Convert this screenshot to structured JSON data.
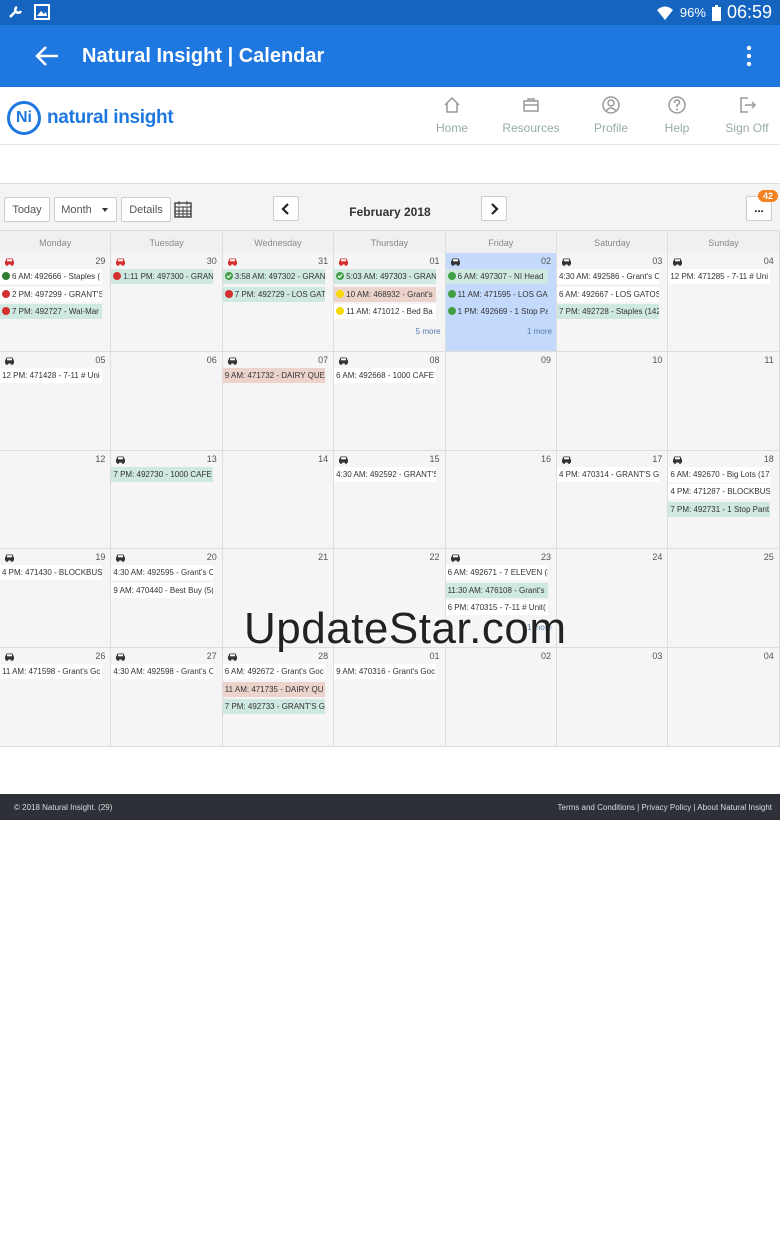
{
  "status": {
    "battery": "96%",
    "time": "06:59"
  },
  "appbar": {
    "title": "Natural Insight | Calendar"
  },
  "brand": {
    "logo_mark": "Ni",
    "logo_text": "natural insight",
    "nav": [
      {
        "label": "Home",
        "icon": "home-icon"
      },
      {
        "label": "Resources",
        "icon": "briefcase-icon"
      },
      {
        "label": "Profile",
        "icon": "user-icon"
      },
      {
        "label": "Help",
        "icon": "help-icon"
      },
      {
        "label": "Sign Off",
        "icon": "sign-out-icon"
      }
    ]
  },
  "toolbar": {
    "today": "Today",
    "view": "Month",
    "details": "Details",
    "month_title": "February 2018",
    "more": "...",
    "badge": "42"
  },
  "calendar": {
    "headers": [
      "Monday",
      "Tuesday",
      "Wednesday",
      "Thursday",
      "Friday",
      "Saturday",
      "Sunday"
    ],
    "weeks": [
      [
        {
          "day": "29",
          "car": "red",
          "events": [
            {
              "text": "6 AM: 492666 - Staples (",
              "dot": "shield"
            },
            {
              "text": "2 PM: 497299 - GRANT'S",
              "dot": "red"
            },
            {
              "text": "7 PM: 492727 - Wal-Mar",
              "dot": "red",
              "style": "green"
            }
          ]
        },
        {
          "day": "30",
          "car": "red",
          "events": [
            {
              "text": "1:11 PM: 497300 - GRAN",
              "dot": "red",
              "style": "green"
            }
          ]
        },
        {
          "day": "31",
          "car": "red",
          "events": [
            {
              "text": "3:58 AM: 497302 - GRAN",
              "dot": "check",
              "style": "green"
            },
            {
              "text": "7 PM: 492729 - LOS GAT",
              "dot": "red",
              "style": "green"
            }
          ]
        },
        {
          "day": "01",
          "car": "red",
          "events": [
            {
              "text": "5:03 AM: 497303 - GRAN",
              "dot": "check",
              "style": "green"
            },
            {
              "text": "10 AM: 468932 - Grant's",
              "dot": "yellow",
              "style": "pink"
            },
            {
              "text": "11 AM: 471012 - Bed Ba",
              "dot": "yellow"
            }
          ],
          "more": "5 more"
        },
        {
          "day": "02",
          "car": "dark",
          "today": true,
          "events": [
            {
              "text": "6 AM: 497307 - NI Head",
              "dot": "green",
              "style": "green"
            },
            {
              "text": "11 AM: 471595 - LOS GA",
              "dot": "green"
            },
            {
              "text": "1 PM: 492669 - 1 Stop Pa",
              "dot": "green"
            }
          ],
          "more": "1 more"
        },
        {
          "day": "03",
          "car": "dark",
          "events": [
            {
              "text": "4:30 AM: 492586 - Grant's C"
            },
            {
              "text": "6 AM: 492667 - LOS GATOS"
            },
            {
              "text": "7 PM: 492728 - Staples (142",
              "style": "green"
            }
          ]
        },
        {
          "day": "04",
          "car": "dark",
          "events": [
            {
              "text": "12 PM: 471285 - 7-11 # Uni"
            }
          ]
        }
      ],
      [
        {
          "day": "05",
          "car": "dark",
          "events": [
            {
              "text": "12 PM: 471428 - 7-11 # Uni"
            }
          ]
        },
        {
          "day": "06",
          "events": []
        },
        {
          "day": "07",
          "car": "dark",
          "events": [
            {
              "text": "9 AM: 471732 - DAIRY QUE",
              "style": "pink"
            }
          ]
        },
        {
          "day": "08",
          "car": "dark",
          "events": [
            {
              "text": "6 AM: 492668 - 1000 CAFE -"
            }
          ]
        },
        {
          "day": "09",
          "events": []
        },
        {
          "day": "10",
          "events": []
        },
        {
          "day": "11",
          "events": []
        }
      ],
      [
        {
          "day": "12",
          "events": []
        },
        {
          "day": "13",
          "car": "dark",
          "events": [
            {
              "text": "7 PM: 492730 - 1000 CAFE (",
              "style": "green"
            }
          ]
        },
        {
          "day": "14",
          "events": []
        },
        {
          "day": "15",
          "car": "dark",
          "events": [
            {
              "text": "4:30 AM: 492592 - GRANT'S"
            }
          ]
        },
        {
          "day": "16",
          "events": []
        },
        {
          "day": "17",
          "car": "dark",
          "events": [
            {
              "text": "4 PM: 470314 - GRANT'S GC"
            }
          ]
        },
        {
          "day": "18",
          "car": "dark",
          "events": [
            {
              "text": "6 AM: 492670 - Big Lots (17"
            },
            {
              "text": "4 PM: 471287 - BLOCKBUST"
            },
            {
              "text": "7 PM: 492731 - 1 Stop Pant",
              "style": "green"
            }
          ]
        }
      ],
      [
        {
          "day": "19",
          "car": "dark",
          "events": [
            {
              "text": "4 PM: 471430 - BLOCKBUST"
            }
          ]
        },
        {
          "day": "20",
          "car": "dark",
          "events": [
            {
              "text": "4:30 AM: 492595 - Grant's C"
            },
            {
              "text": "9 AM: 470440 - Best Buy (5("
            }
          ]
        },
        {
          "day": "21",
          "events": []
        },
        {
          "day": "22",
          "events": []
        },
        {
          "day": "23",
          "car": "dark",
          "events": [
            {
              "text": "6 AM: 492671 - 7 ELEVEN (3"
            },
            {
              "text": "11:30 AM: 476108 - Grant's",
              "style": "green"
            },
            {
              "text": "6 PM: 470315 - 7-11 # Unit("
            }
          ],
          "more": "1 more"
        },
        {
          "day": "24",
          "events": []
        },
        {
          "day": "25",
          "events": []
        }
      ],
      [
        {
          "day": "26",
          "car": "dark",
          "events": [
            {
              "text": "11 AM: 471598 - Grant's Gc"
            }
          ]
        },
        {
          "day": "27",
          "car": "dark",
          "events": [
            {
              "text": "4:30 AM: 492598 - Grant's C"
            }
          ]
        },
        {
          "day": "28",
          "car": "dark",
          "events": [
            {
              "text": "6 AM: 492672 - Grant's Goc"
            },
            {
              "text": "11 AM: 471735 - DAIRY QU",
              "style": "pink"
            },
            {
              "text": "7 PM: 492733 - GRANT'S GC",
              "style": "green"
            }
          ]
        },
        {
          "day": "01",
          "events": [
            {
              "text": "9 AM: 470316 - Grant's Goc"
            }
          ]
        },
        {
          "day": "02",
          "events": []
        },
        {
          "day": "03",
          "events": []
        },
        {
          "day": "04",
          "events": []
        }
      ]
    ]
  },
  "footer": {
    "copyright": "© 2018 Natural Insight. (29)",
    "links": "Terms and Conditions | Privacy Policy | About Natural Insight"
  },
  "watermark": "UpdateStar.com"
}
